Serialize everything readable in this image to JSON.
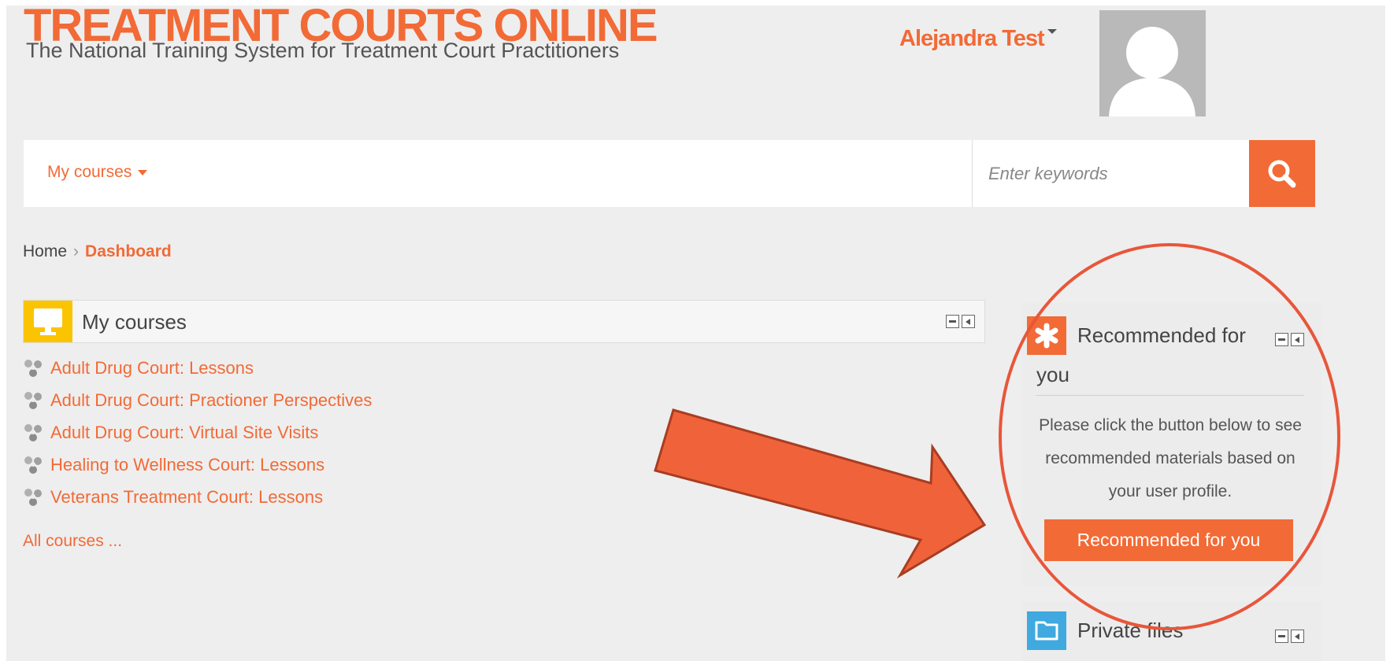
{
  "header": {
    "title": "TREATMENT COURTS ONLINE",
    "subtitle": "The National Training System for Treatment Court Practitioners",
    "user_name": "Alejandra Test"
  },
  "nav": {
    "my_courses_label": "My courses",
    "search_placeholder": "Enter keywords"
  },
  "breadcrumb": {
    "home": "Home",
    "current": "Dashboard"
  },
  "my_courses_block": {
    "title": "My courses",
    "courses": [
      "Adult Drug Court: Lessons",
      "Adult Drug Court: Practioner Perspectives",
      "Adult Drug Court: Virtual Site Visits",
      "Healing to Wellness Court: Lessons",
      "Veterans Treatment Court: Lessons"
    ],
    "all_courses_link": "All courses ..."
  },
  "recommended_block": {
    "title_line1": "Recommended for",
    "title_line2": "you",
    "description": "Please click the button below to see recommended materials based on your user profile.",
    "button_label": "Recommended for you"
  },
  "private_files_block": {
    "title": "Private files"
  },
  "colors": {
    "brand_orange": "#f26a36",
    "mycourses_icon_bg": "#fac402",
    "files_icon_bg": "#3fa9e0",
    "annotation": "#e8563a"
  },
  "icons": {
    "mycourses": "monitor-icon",
    "recommended": "asterisk-icon",
    "files": "folder-icon",
    "search": "search-icon",
    "course": "course-icon"
  }
}
